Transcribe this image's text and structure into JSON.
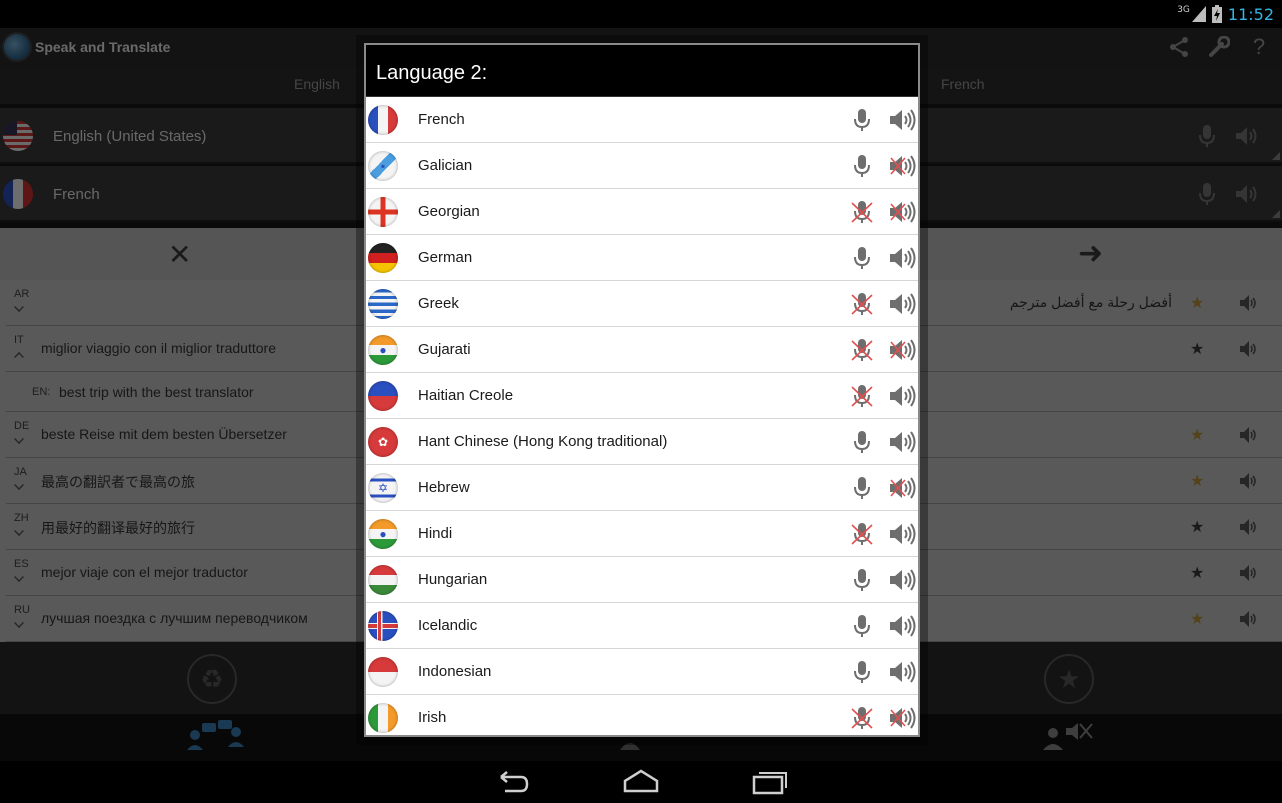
{
  "status_bar": {
    "network": "3G",
    "time": "11:52"
  },
  "app": {
    "title": "Speak and Translate",
    "lang1_tab": "English",
    "lang2_tab": "French",
    "lang_rows": [
      {
        "label": "English (United States)",
        "flag": "us"
      },
      {
        "label": "French",
        "flag": "fr"
      }
    ],
    "history": [
      {
        "code": "AR",
        "text": "أفضل رحلة مع أفضل مترجم",
        "rtl": true,
        "star": "gold"
      },
      {
        "code": "IT",
        "text": "miglior viaggio con il miglior traduttore",
        "rtl": false,
        "star": "dark",
        "expanded": true,
        "sub": {
          "code": "EN:",
          "text": "best trip with the best translator"
        }
      },
      {
        "code": "DE",
        "text": "beste Reise mit dem besten Übersetzer",
        "rtl": false,
        "star": "gold"
      },
      {
        "code": "JA",
        "text": "最高の翻訳者で最高の旅",
        "rtl": false,
        "star": "gold"
      },
      {
        "code": "ZH",
        "text": "用最好的翻译最好的旅行",
        "rtl": false,
        "star": "dark"
      },
      {
        "code": "ES",
        "text": "mejor viaje con el mejor traductor",
        "rtl": false,
        "star": "dark"
      },
      {
        "code": "RU",
        "text": "лучшая поездка с лучшим переводчиком",
        "rtl": false,
        "star": "gold"
      }
    ]
  },
  "dialog": {
    "title": "Language 2:",
    "languages": [
      {
        "name": "French",
        "flag": "fr",
        "mic": true,
        "speaker": true
      },
      {
        "name": "Galician",
        "flag": "gl",
        "mic": true,
        "speaker": false
      },
      {
        "name": "Georgian",
        "flag": "ge",
        "mic": false,
        "speaker": false
      },
      {
        "name": "German",
        "flag": "de",
        "mic": true,
        "speaker": true
      },
      {
        "name": "Greek",
        "flag": "gr",
        "mic": false,
        "speaker": true
      },
      {
        "name": "Gujarati",
        "flag": "in",
        "mic": false,
        "speaker": false
      },
      {
        "name": "Haitian Creole",
        "flag": "ht",
        "mic": false,
        "speaker": true
      },
      {
        "name": "Hant Chinese (Hong Kong traditional)",
        "flag": "hk",
        "mic": true,
        "speaker": true
      },
      {
        "name": "Hebrew",
        "flag": "il",
        "mic": true,
        "speaker": false
      },
      {
        "name": "Hindi",
        "flag": "in",
        "mic": false,
        "speaker": true
      },
      {
        "name": "Hungarian",
        "flag": "hu",
        "mic": true,
        "speaker": true
      },
      {
        "name": "Icelandic",
        "flag": "is",
        "mic": true,
        "speaker": true
      },
      {
        "name": "Indonesian",
        "flag": "id",
        "mic": true,
        "speaker": true
      },
      {
        "name": "Irish",
        "flag": "ie",
        "mic": false,
        "speaker": false
      }
    ]
  },
  "colors": {
    "accent": "#33b5e5",
    "gold_star": "#b8923a",
    "disabled_x": "#e05050"
  }
}
